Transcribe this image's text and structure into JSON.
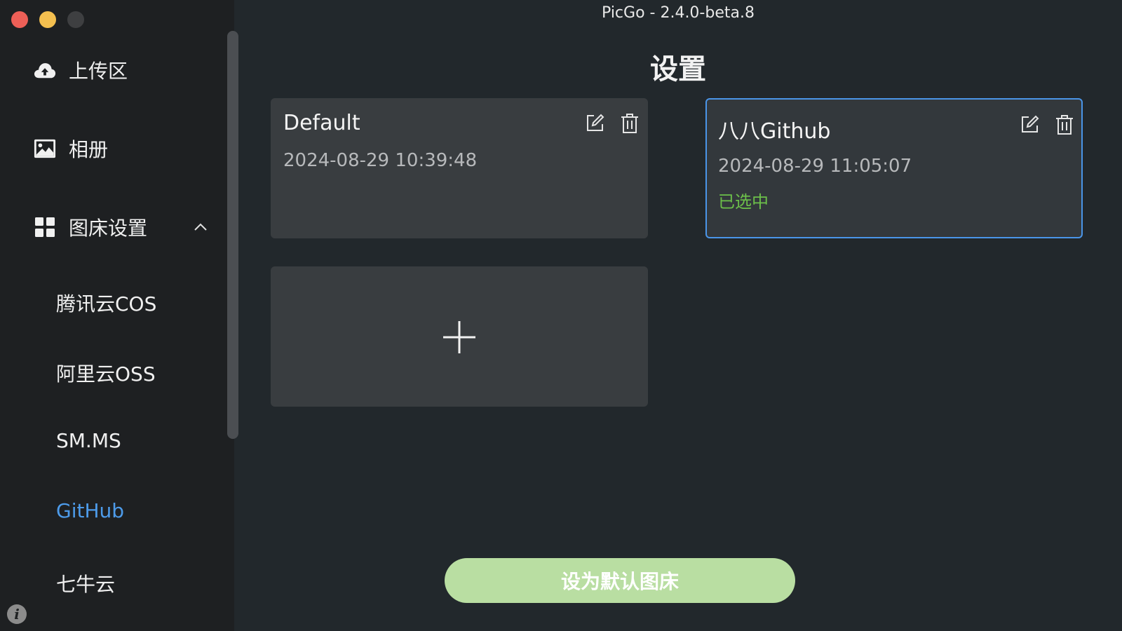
{
  "window": {
    "title": "PicGo - 2.4.0-beta.8"
  },
  "sidebar": {
    "nav": [
      {
        "label": "上传区",
        "icon": "cloud-upload-icon"
      },
      {
        "label": "相册",
        "icon": "image-icon"
      },
      {
        "label": "图床设置",
        "icon": "grid-icon",
        "expanded": true
      }
    ],
    "picbeds": [
      {
        "label": "腾讯云COS",
        "active": false
      },
      {
        "label": "阿里云OSS",
        "active": false
      },
      {
        "label": "SM.MS",
        "active": false
      },
      {
        "label": "GitHub",
        "active": true
      },
      {
        "label": "七牛云",
        "active": false
      }
    ],
    "info_icon": "i"
  },
  "main": {
    "page_title": "设置",
    "configs": [
      {
        "name": "Default",
        "date": "2024-08-29 10:39:48",
        "selected": false,
        "status": ""
      },
      {
        "name": "八八Github",
        "date": "2024-08-29 11:05:07",
        "selected": true,
        "status": "已选中"
      }
    ],
    "add_icon": "plus-icon",
    "default_button": "设为默认图床"
  },
  "colors": {
    "accent_blue": "#4a95e8",
    "active_link": "#4d9bea",
    "selected_green": "#6cc04a",
    "button_green": "#b9dea2",
    "sidebar_bg": "#1e2022",
    "main_bg": "#22282c",
    "card_bg": "#393d40"
  }
}
